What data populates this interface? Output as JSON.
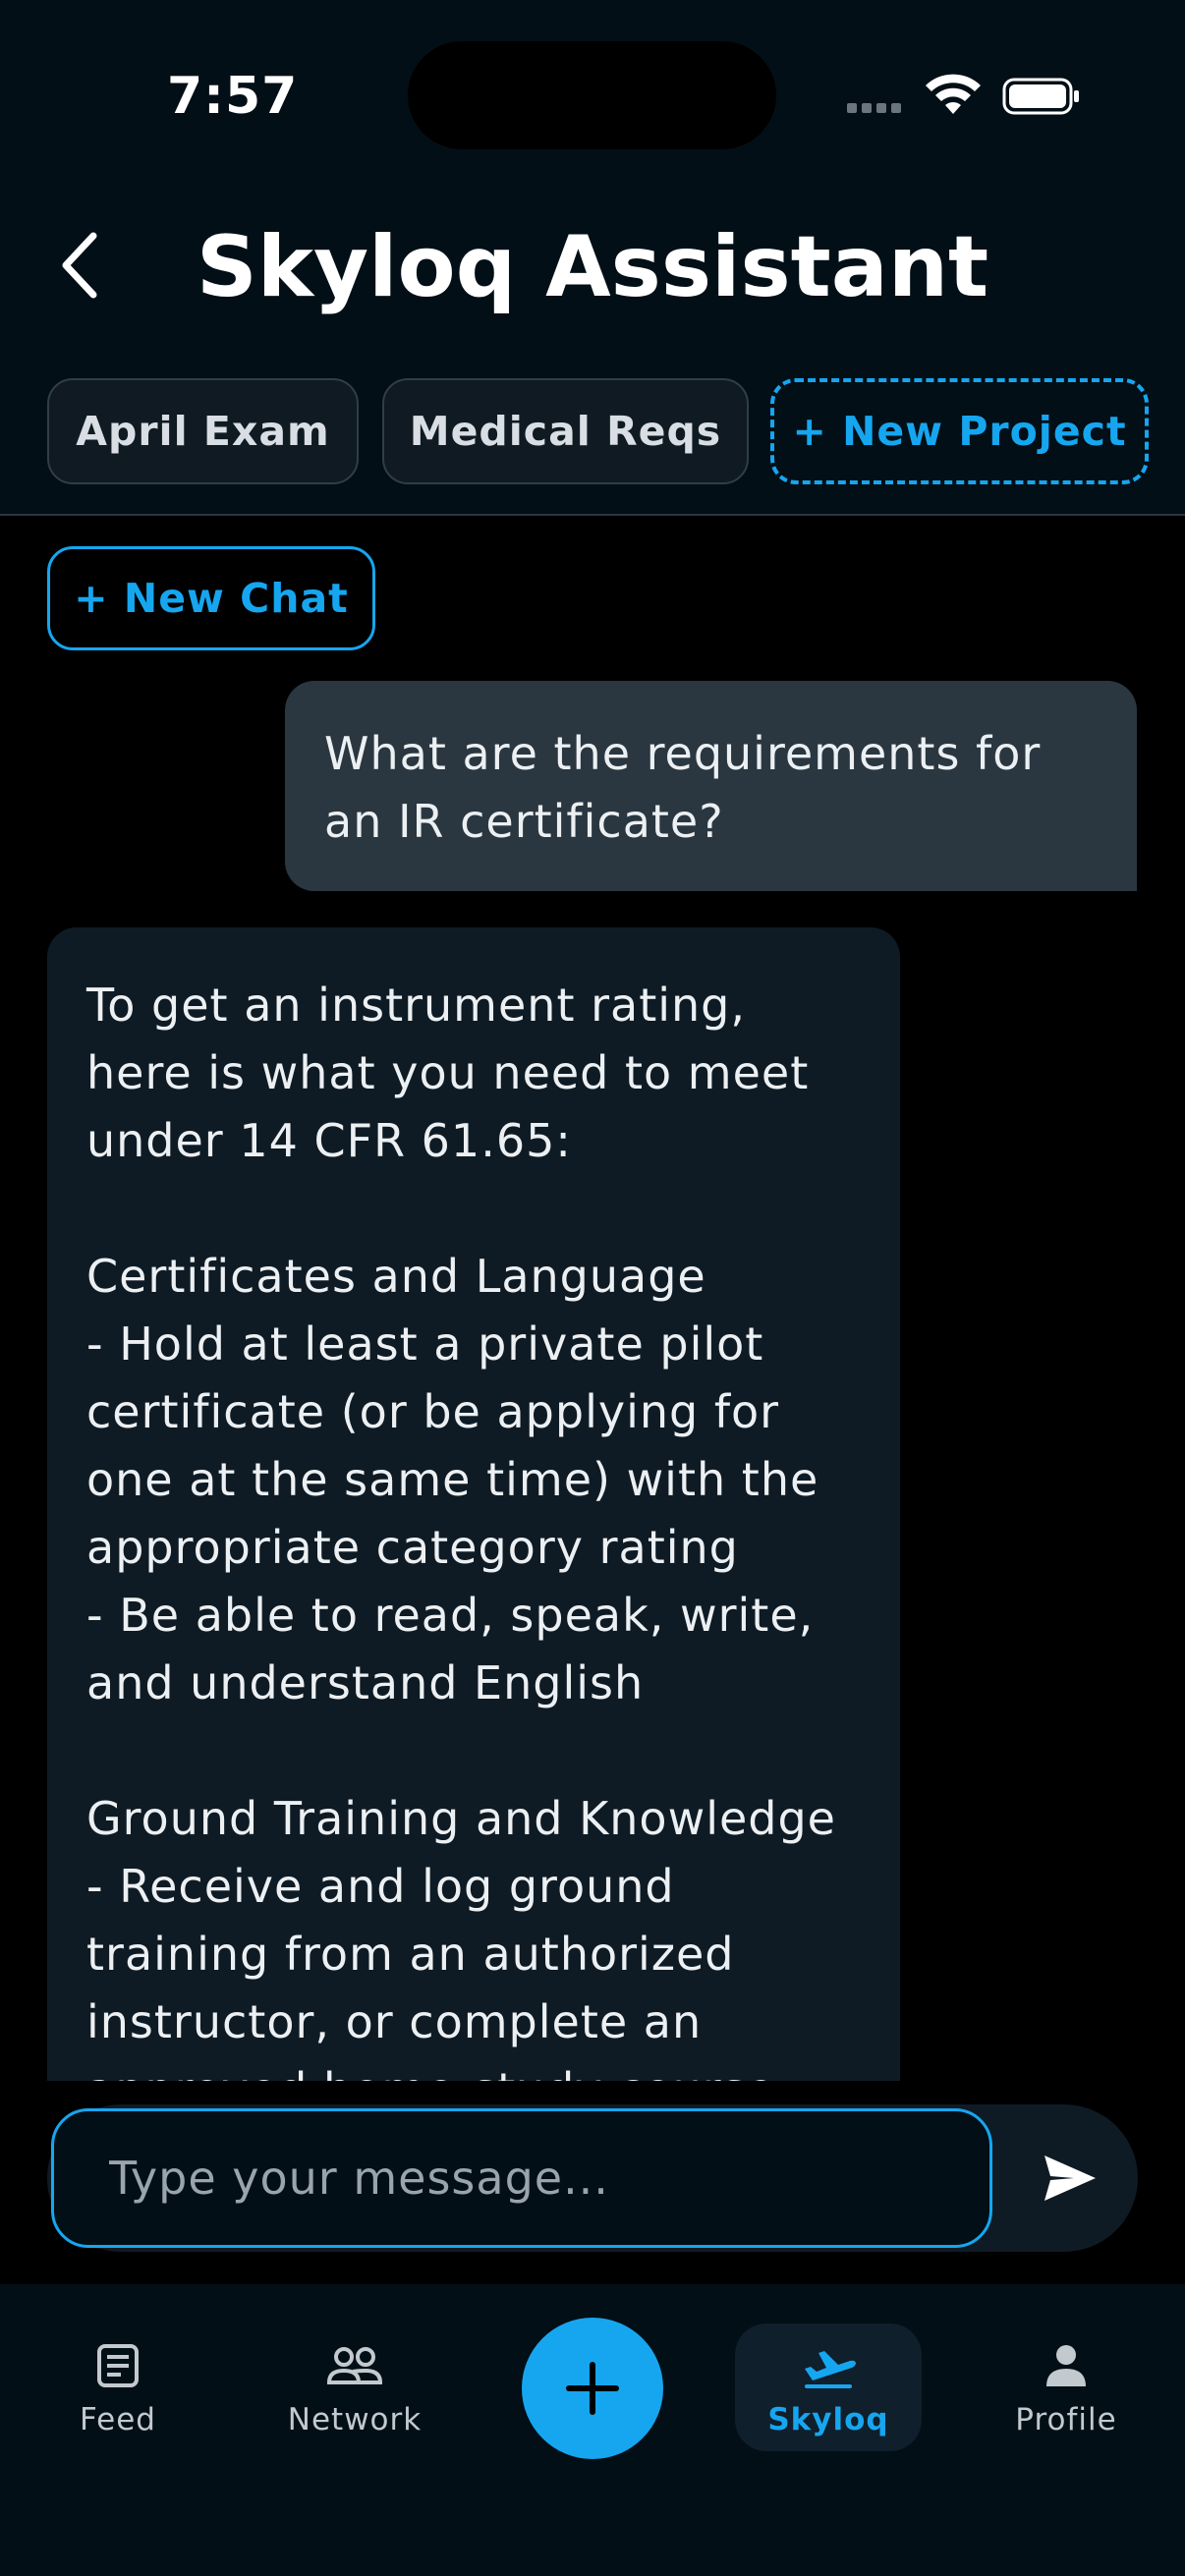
{
  "status_bar": {
    "time": "7:57"
  },
  "header": {
    "title": "Skyloq Assistant"
  },
  "projects": {
    "items": [
      {
        "label": "April Exam"
      },
      {
        "label": "Medical Reqs"
      }
    ],
    "new_project_label": "+ New Project"
  },
  "new_chat_label": "+ New Chat",
  "chat": {
    "messages": [
      {
        "role": "user",
        "text": "What are the requirements for an IR certificate?"
      },
      {
        "role": "assistant",
        "text": "To get an instrument rating, here is what you need to meet under 14 CFR 61.65:\n\nCertificates and Language\n- Hold at least a private pilot certificate (or be applying for one at the same time) with the appropriate category rating\n- Be able to read, speak, write, and understand English\n\nGround Training and Knowledge\n- Receive and log ground training from an authorized instructor, or complete an approved home-study course covering the"
      }
    ]
  },
  "input": {
    "placeholder": "Type your message..."
  },
  "bottom_nav": {
    "items": [
      {
        "label": "Feed",
        "icon": "feed-icon"
      },
      {
        "label": "Network",
        "icon": "network-icon"
      },
      {
        "label": "Skyloq",
        "icon": "airplane-takeoff-icon",
        "active": true
      },
      {
        "label": "Profile",
        "icon": "profile-icon"
      }
    ],
    "fab_icon": "plus-icon"
  },
  "colors": {
    "accent": "#16A6F0",
    "background": "#000000",
    "surface": "#0F1B24",
    "user_bubble": "#2A3740"
  }
}
